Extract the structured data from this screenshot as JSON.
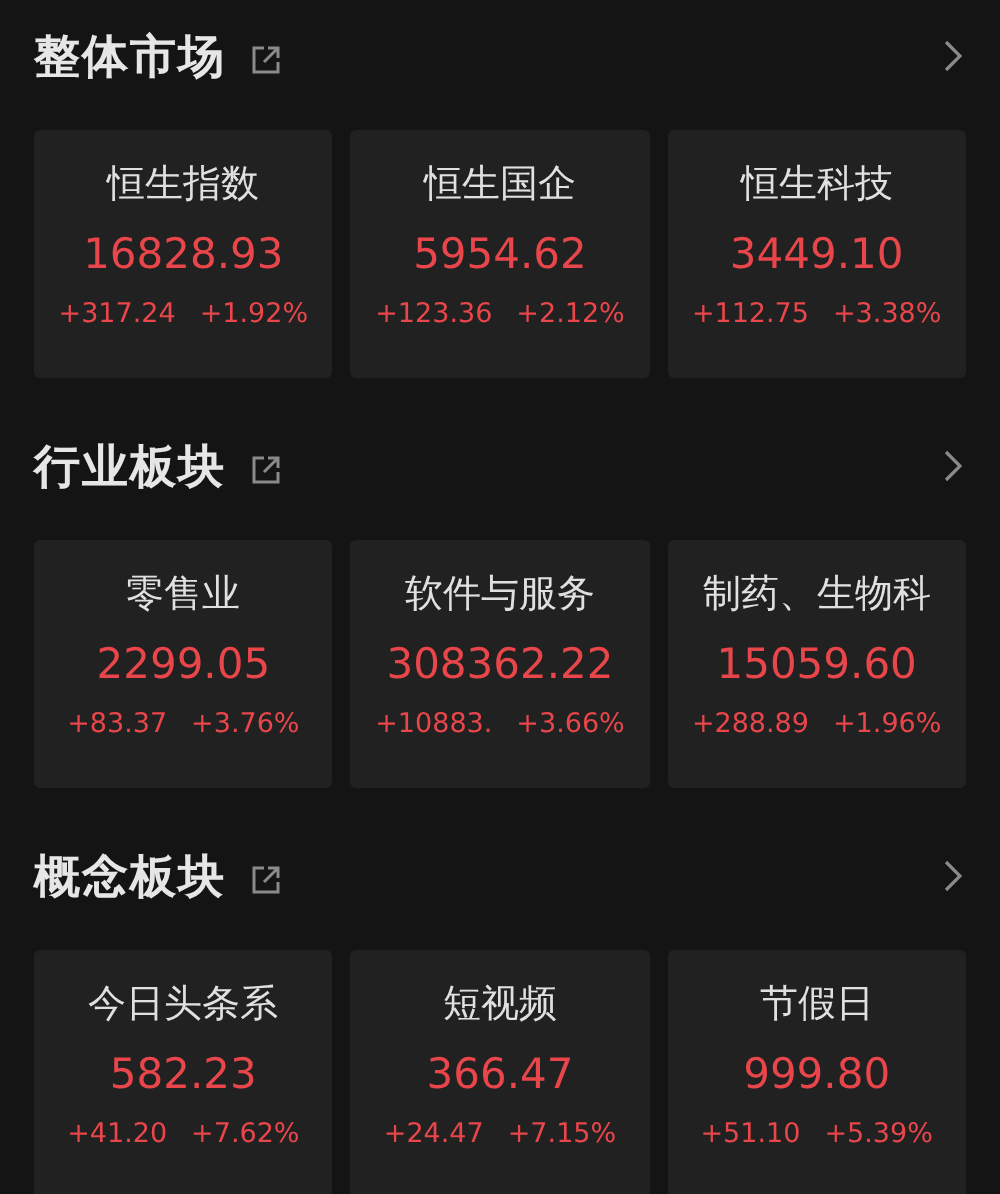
{
  "sections": [
    {
      "title": "整体市场",
      "cards": [
        {
          "name": "恒生指数",
          "value": "16828.93",
          "change": "+317.24",
          "percent": "+1.92%"
        },
        {
          "name": "恒生国企",
          "value": "5954.62",
          "change": "+123.36",
          "percent": "+2.12%"
        },
        {
          "name": "恒生科技",
          "value": "3449.10",
          "change": "+112.75",
          "percent": "+3.38%"
        }
      ]
    },
    {
      "title": "行业板块",
      "cards": [
        {
          "name": "零售业",
          "value": "2299.05",
          "change": "+83.37",
          "percent": "+3.76%"
        },
        {
          "name": "软件与服务",
          "value": "308362.22",
          "change": "+10883.",
          "percent": "+3.66%"
        },
        {
          "name": "制药、生物科",
          "value": "15059.60",
          "change": "+288.89",
          "percent": "+1.96%"
        }
      ]
    },
    {
      "title": "概念板块",
      "cards": [
        {
          "name": "今日头条系",
          "value": "582.23",
          "change": "+41.20",
          "percent": "+7.62%"
        },
        {
          "name": "短视频",
          "value": "366.47",
          "change": "+24.47",
          "percent": "+7.15%"
        },
        {
          "name": "节假日",
          "value": "999.80",
          "change": "+51.10",
          "percent": "+5.39%"
        }
      ]
    }
  ]
}
